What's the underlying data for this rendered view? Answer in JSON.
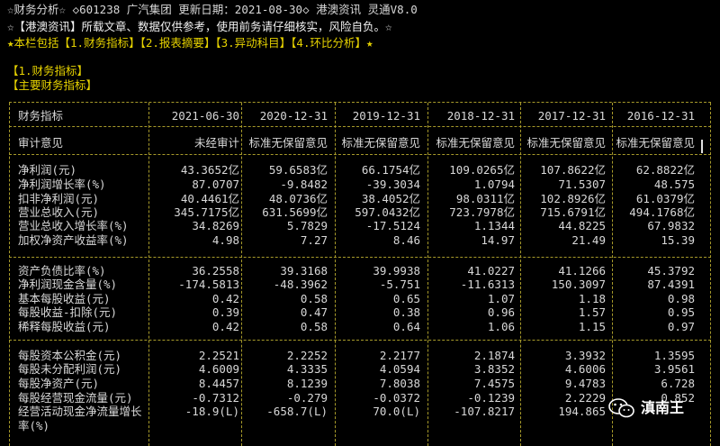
{
  "header": {
    "line1": "☆财务分析☆ ◇601238 广汽集团 更新日期：2021-08-30◇ 港澳资讯 灵通V8.0",
    "line2": "☆【港澳资讯】所载文章、数据仅供参考，使用前务请仔细核实，风险自负。☆",
    "line3": "★本栏包括【1.财务指标】【2.报表摘要】【3.异动科目】【4.环比分析】★",
    "section1": "【1.财务指标】",
    "section2": "【主要财务指标】"
  },
  "table": {
    "header_label": "财务指标",
    "dates": [
      "2021-06-30",
      "2020-12-31",
      "2019-12-31",
      "2018-12-31",
      "2017-12-31",
      "2016-12-31"
    ],
    "audit_label": "审计意见",
    "audit": [
      "未经审计",
      "标准无保留意见",
      "标准无保留意见",
      "标准无保留意见",
      "标准无保留意见",
      "标准无保留意见"
    ],
    "group1": [
      {
        "label": "净利润(元)",
        "values": [
          "43.3652亿",
          "59.6583亿",
          "66.1754亿",
          "109.0265亿",
          "107.8622亿",
          "62.8822亿"
        ]
      },
      {
        "label": "净利润增长率(%)",
        "values": [
          "87.0707",
          "-9.8482",
          "-39.3034",
          "1.0794",
          "71.5307",
          "48.575"
        ]
      },
      {
        "label": "扣非净利润(元)",
        "values": [
          "40.4461亿",
          "48.0736亿",
          "38.4052亿",
          "98.0311亿",
          "102.8926亿",
          "61.0379亿"
        ]
      },
      {
        "label": "营业总收入(元)",
        "values": [
          "345.7175亿",
          "631.5699亿",
          "597.0432亿",
          "723.7978亿",
          "715.6791亿",
          "494.1768亿"
        ]
      },
      {
        "label": "营业总收入增长率(%)",
        "values": [
          "34.8269",
          "5.7829",
          "-17.5124",
          "1.1344",
          "44.8225",
          "67.9832"
        ]
      },
      {
        "label": "加权净资产收益率(%)",
        "values": [
          "4.98",
          "7.27",
          "8.46",
          "14.97",
          "21.49",
          "15.39"
        ]
      }
    ],
    "group2": [
      {
        "label": "资产负债比率(%)",
        "values": [
          "36.2558",
          "39.3168",
          "39.9938",
          "41.0227",
          "41.1266",
          "45.3792"
        ]
      },
      {
        "label": "净利润现金含量(%)",
        "values": [
          "-174.5813",
          "-48.3962",
          "-5.751",
          "-11.6313",
          "150.3097",
          "87.4391"
        ]
      },
      {
        "label": "基本每股收益(元)",
        "values": [
          "0.42",
          "0.58",
          "0.65",
          "1.07",
          "1.18",
          "0.98"
        ]
      },
      {
        "label": "每股收益-扣除(元)",
        "values": [
          "0.39",
          "0.47",
          "0.38",
          "0.96",
          "1.57",
          "0.95"
        ]
      },
      {
        "label": "稀释每股收益(元)",
        "values": [
          "0.42",
          "0.58",
          "0.64",
          "1.06",
          "1.15",
          "0.97"
        ]
      }
    ],
    "group3": [
      {
        "label": "每股资本公积金(元)",
        "values": [
          "2.2521",
          "2.2252",
          "2.2177",
          "2.1874",
          "3.3932",
          "1.3595"
        ]
      },
      {
        "label": "每股未分配利润(元)",
        "values": [
          "4.6009",
          "4.3335",
          "4.0594",
          "3.8352",
          "4.6006",
          "3.9561"
        ]
      },
      {
        "label": "每股净资产(元)",
        "values": [
          "8.4457",
          "8.1239",
          "7.8038",
          "7.4575",
          "9.4783",
          "6.728"
        ]
      },
      {
        "label": "每股经营现金流量(元)",
        "values": [
          "-0.7312",
          "-0.279",
          "-0.0372",
          "-0.1239",
          "2.2229",
          "0.852"
        ]
      },
      {
        "label": "经营活动现金净流量增长",
        "values": [
          "-18.9(L)",
          "-658.7(L)",
          "70.0(L)",
          "-107.8217",
          "194.865",
          ""
        ]
      },
      {
        "label": "率(%)",
        "values": [
          "",
          "",
          "",
          "",
          "",
          ""
        ]
      }
    ]
  },
  "watermark": {
    "text": "滇南王",
    "icon": "wechat-icon"
  }
}
